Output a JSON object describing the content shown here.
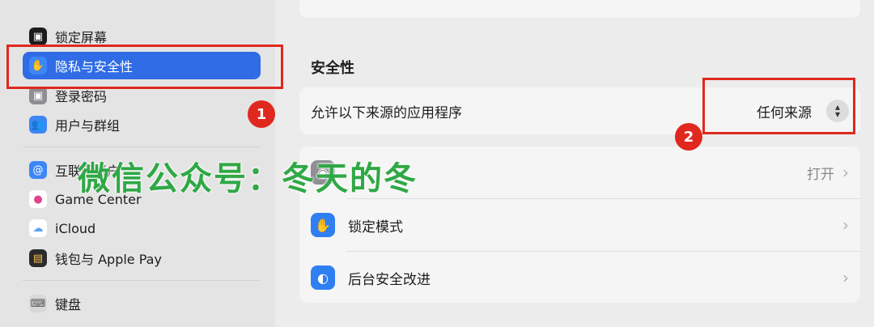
{
  "sidebar": {
    "items": [
      {
        "label": "锁定屏幕",
        "icon": "lock-icon"
      },
      {
        "label": "隐私与安全性",
        "icon": "hand-icon"
      },
      {
        "label": "登录密码",
        "icon": "lock-icon"
      },
      {
        "label": "用户与群组",
        "icon": "users-icon"
      },
      {
        "label": "互联网帐户",
        "icon": "at-icon"
      },
      {
        "label": "Game Center",
        "icon": "game-center-icon"
      },
      {
        "label": "iCloud",
        "icon": "icloud-icon"
      },
      {
        "label": "钱包与 Apple Pay",
        "icon": "wallet-icon"
      },
      {
        "label": "键盘",
        "icon": "keyboard-icon"
      }
    ]
  },
  "main": {
    "section_title": "安全性",
    "allow_apps_label": "允许以下来源的应用程序",
    "allow_apps_value": "任何来源",
    "filevault_value": "打开",
    "lockdown_label": "锁定模式",
    "background_security_label": "后台安全改进"
  },
  "annotations": {
    "badge1": "1",
    "badge2": "2",
    "watermark": "微信公众号：冬天的冬"
  }
}
